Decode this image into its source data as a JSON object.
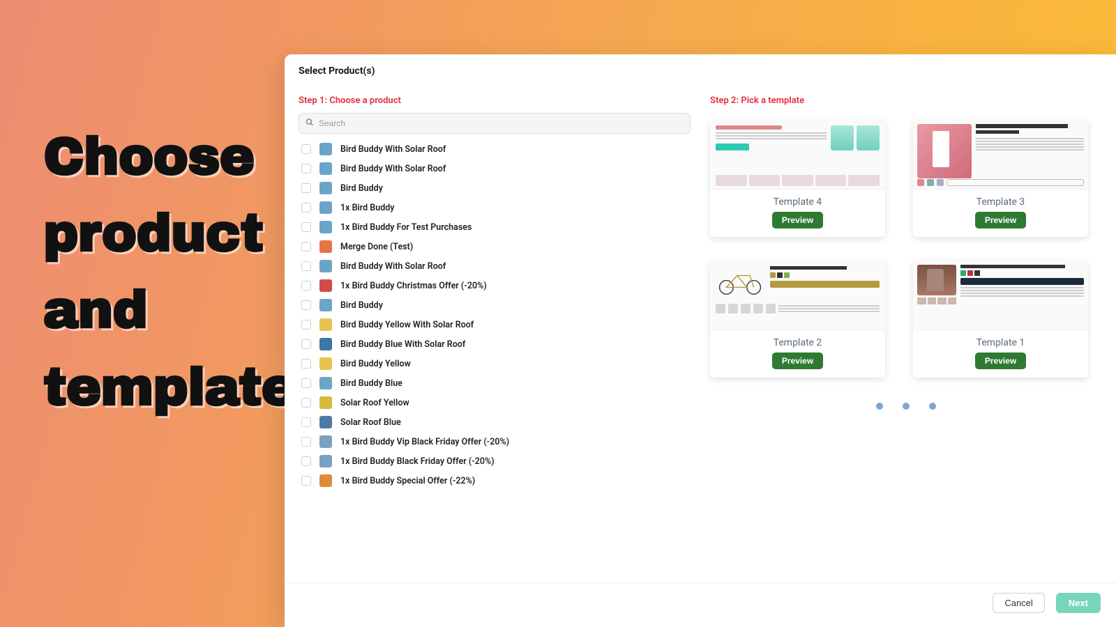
{
  "hero": {
    "line1": "Choose",
    "line2": "product",
    "line3": "and",
    "line4": "template"
  },
  "modal": {
    "title": "Select Product(s)",
    "step1_label": "Step 1: Choose a product",
    "step2_label": "Step 2: Pick a template",
    "search": {
      "placeholder": "Search",
      "value": ""
    },
    "footer": {
      "cancel": "Cancel",
      "next": "Next"
    }
  },
  "products": [
    {
      "name": "Bird Buddy With Solar Roof",
      "icon": "bb-blue-solar"
    },
    {
      "name": "Bird Buddy With Solar Roof",
      "icon": "bb-blue-solar"
    },
    {
      "name": "Bird Buddy",
      "icon": "bb-blue"
    },
    {
      "name": "1x Bird Buddy",
      "icon": "bb-blue"
    },
    {
      "name": "1x Bird Buddy For Test Purchases",
      "icon": "bb-blue"
    },
    {
      "name": "Merge Done (Test)",
      "icon": "merge"
    },
    {
      "name": "Bird Buddy With Solar Roof",
      "icon": "bb-blue-solar"
    },
    {
      "name": "1x Bird Buddy Christmas Offer (-20%)",
      "icon": "xmas"
    },
    {
      "name": "Bird Buddy",
      "icon": "bb-blue"
    },
    {
      "name": "Bird Buddy Yellow With Solar Roof",
      "icon": "bb-yellow-solar"
    },
    {
      "name": "Bird Buddy Blue With Solar Roof",
      "icon": "bb-blue-shirt"
    },
    {
      "name": "Bird Buddy Yellow",
      "icon": "bb-yellow"
    },
    {
      "name": "Bird Buddy Blue",
      "icon": "bb-blue"
    },
    {
      "name": "Solar Roof Yellow",
      "icon": "roof-yellow"
    },
    {
      "name": "Solar Roof Blue",
      "icon": "roof-blue"
    },
    {
      "name": "1x Bird Buddy Vip Black Friday Offer (-20%)",
      "icon": "bf"
    },
    {
      "name": "1x Bird Buddy Black Friday Offer (-20%)",
      "icon": "bf"
    },
    {
      "name": "1x Bird Buddy Special Offer (-22%)",
      "icon": "special"
    }
  ],
  "templates": [
    {
      "title": "Template 4",
      "button": "Preview",
      "kind": "pv4"
    },
    {
      "title": "Template 3",
      "button": "Preview",
      "kind": "pv3"
    },
    {
      "title": "Template 2",
      "button": "Preview",
      "kind": "pv2"
    },
    {
      "title": "Template 1",
      "button": "Preview",
      "kind": "pv1"
    }
  ],
  "thumb_colors": {
    "bb-blue-solar": "#6aa5c9",
    "bb-blue": "#6aa5c9",
    "merge": "#e57348",
    "xmas": "#d14b4b",
    "bb-yellow-solar": "#e8c34d",
    "bb-blue-shirt": "#3a76a8",
    "bb-yellow": "#e8c34d",
    "roof-yellow": "#d8b93a",
    "roof-blue": "#4a7ba6",
    "bf": "#7aa0c2",
    "special": "#e0893a"
  }
}
